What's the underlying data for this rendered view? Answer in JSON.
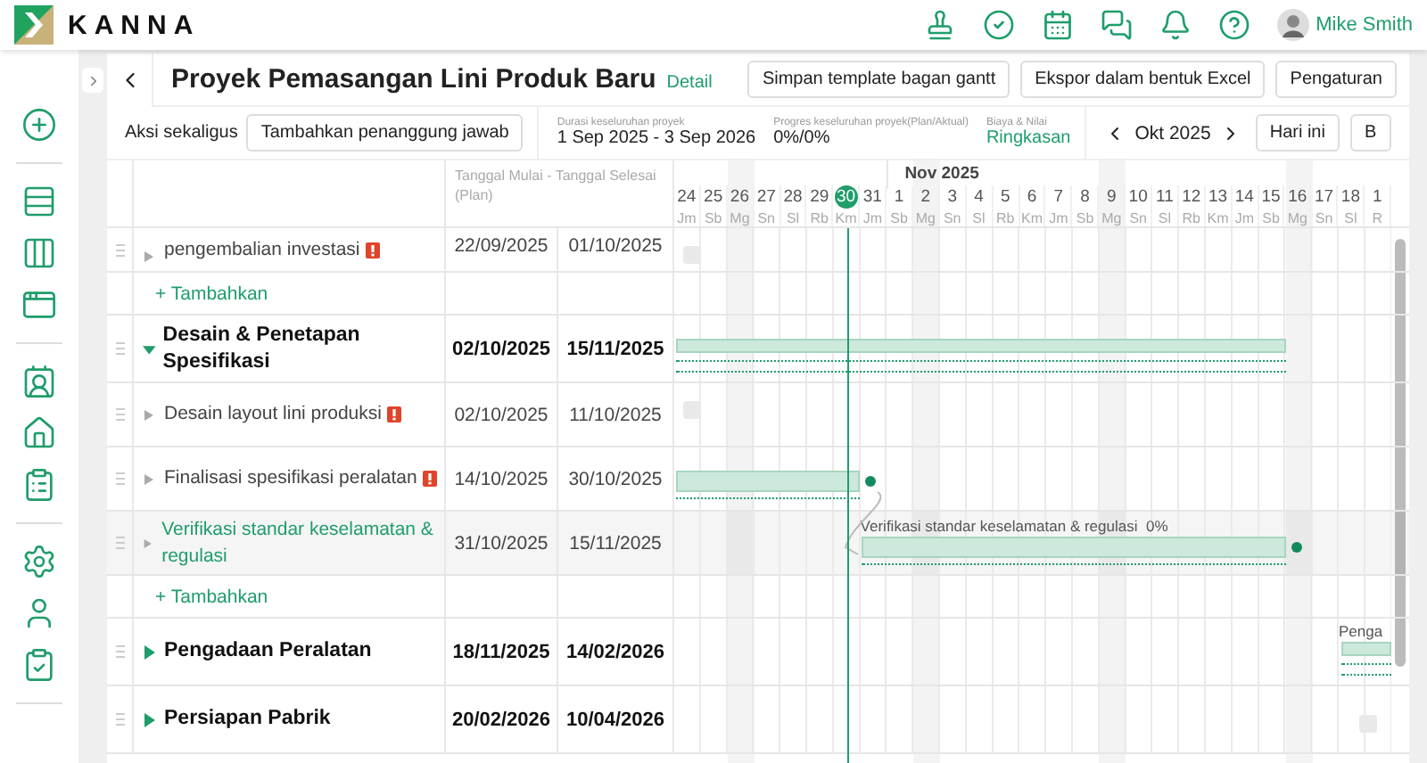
{
  "header": {
    "brand": "KANNA",
    "user": "Mike Smith"
  },
  "project": {
    "title": "Proyek Pemasangan Lini Produk Baru",
    "detail_link": "Detail",
    "buttons": [
      "Simpan template bagan gantt",
      "Ekspor dalam bentuk Excel",
      "Pengaturan"
    ]
  },
  "toolbar": {
    "bulk_label": "Aksi sekaligus",
    "bulk_button": "Tambahkan penanggung jawab",
    "stats": [
      {
        "label": "Durasi keseluruhan proyek",
        "value": "1 Sep 2025 - 3 Sep 2026",
        "kind": "text"
      },
      {
        "label": "Progres keseluruhan proyek(Plan/Aktual)",
        "value": "0%/0%",
        "kind": "text"
      },
      {
        "label": "Biaya & Nilai",
        "value": "Ringkasan",
        "kind": "link"
      }
    ],
    "month": "Okt 2025",
    "today_button": "Hari ini",
    "view_button": "B"
  },
  "table": {
    "date_header": "Tanggal Mulai - Tanggal Selesai (Plan)",
    "month_label": "Nov 2025",
    "days": [
      {
        "day": "24",
        "weekday": "Jm",
        "holiday": false,
        "selected": false
      },
      {
        "day": "25",
        "weekday": "Sb",
        "holiday": false,
        "selected": false
      },
      {
        "day": "26",
        "weekday": "Mg",
        "holiday": true,
        "selected": false
      },
      {
        "day": "27",
        "weekday": "Sn",
        "holiday": false,
        "selected": false
      },
      {
        "day": "28",
        "weekday": "Sl",
        "holiday": false,
        "selected": false
      },
      {
        "day": "29",
        "weekday": "Rb",
        "holiday": false,
        "selected": false
      },
      {
        "day": "30",
        "weekday": "Km",
        "holiday": false,
        "selected": true
      },
      {
        "day": "31",
        "weekday": "Jm",
        "holiday": false,
        "selected": false
      },
      {
        "day": "1",
        "weekday": "Sb",
        "holiday": false,
        "selected": false
      },
      {
        "day": "2",
        "weekday": "Mg",
        "holiday": true,
        "selected": false
      },
      {
        "day": "3",
        "weekday": "Sn",
        "holiday": false,
        "selected": false
      },
      {
        "day": "4",
        "weekday": "Sl",
        "holiday": false,
        "selected": false
      },
      {
        "day": "5",
        "weekday": "Rb",
        "holiday": false,
        "selected": false
      },
      {
        "day": "6",
        "weekday": "Km",
        "holiday": false,
        "selected": false
      },
      {
        "day": "7",
        "weekday": "Jm",
        "holiday": false,
        "selected": false
      },
      {
        "day": "8",
        "weekday": "Sb",
        "holiday": false,
        "selected": false
      },
      {
        "day": "9",
        "weekday": "Mg",
        "holiday": true,
        "selected": false
      },
      {
        "day": "10",
        "weekday": "Sn",
        "holiday": false,
        "selected": false
      },
      {
        "day": "11",
        "weekday": "Sl",
        "holiday": false,
        "selected": false
      },
      {
        "day": "12",
        "weekday": "Rb",
        "holiday": false,
        "selected": false
      },
      {
        "day": "13",
        "weekday": "Km",
        "holiday": false,
        "selected": false
      },
      {
        "day": "14",
        "weekday": "Jm",
        "holiday": false,
        "selected": false
      },
      {
        "day": "15",
        "weekday": "Sb",
        "holiday": false,
        "selected": false
      },
      {
        "day": "16",
        "weekday": "Mg",
        "holiday": true,
        "selected": false
      },
      {
        "day": "17",
        "weekday": "Sn",
        "holiday": false,
        "selected": false
      },
      {
        "day": "18",
        "weekday": "Sl",
        "holiday": false,
        "selected": false
      },
      {
        "day": "1",
        "weekday": "R",
        "holiday": false,
        "selected": false
      }
    ],
    "rows": [
      {
        "kind": "task",
        "name": "pengembalian investasi",
        "warning": true,
        "selected": false,
        "start": "22/09/2025",
        "end": "01/10/2025"
      },
      {
        "kind": "add",
        "label": "+ Tambahkan"
      },
      {
        "kind": "group",
        "name": "Desain & Penetapan Spesifikasi",
        "expanded": true,
        "selected": false,
        "start": "02/10/2025",
        "end": "15/11/2025"
      },
      {
        "kind": "task",
        "name": "Desain layout lini produksi",
        "warning": true,
        "selected": false,
        "start": "02/10/2025",
        "end": "11/10/2025"
      },
      {
        "kind": "task",
        "name": "Finalisasi spesifikasi peralatan",
        "warning": true,
        "selected": false,
        "start": "14/10/2025",
        "end": "30/10/2025"
      },
      {
        "kind": "task",
        "name": "Verifikasi standar keselamatan & regulasi",
        "warning": false,
        "selected": true,
        "start": "31/10/2025",
        "end": "15/11/2025",
        "bar_label": "Verifikasi standar keselamatan & regulasi",
        "bar_progress": "0%",
        "dependency": true
      },
      {
        "kind": "add",
        "label": "+ Tambahkan"
      },
      {
        "kind": "group",
        "name": "Pengadaan Peralatan",
        "expanded": false,
        "selected": false,
        "start": "18/11/2025",
        "end": "14/02/2026",
        "bar_label": "Penga"
      },
      {
        "kind": "group",
        "name": "Persiapan Pabrik",
        "expanded": false,
        "selected": false,
        "start": "20/02/2026",
        "end": "10/04/2026"
      }
    ]
  }
}
